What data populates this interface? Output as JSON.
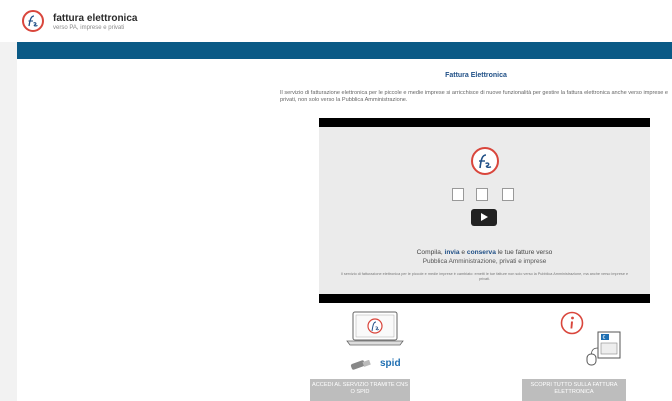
{
  "header": {
    "brand_title": "fattura elettronica",
    "brand_subtitle": "verso PA, imprese e privati"
  },
  "main": {
    "title": "Fattura Elettronica",
    "description": "Il servizio di fatturazione elettronica per le piccole e medie imprese si arricchisce di nuove funzionalità per gestire la fattura elettronica anche verso imprese e privati, non solo verso la Pubblica Amministrazione."
  },
  "video": {
    "headline_pre": "Compila, ",
    "headline_invia": "invia",
    "headline_mid": " e ",
    "headline_conserva": "conserva",
    "headline_post": " le tue fatture verso",
    "headline_line2": "Pubblica Amministrazione, privati e imprese",
    "small_text": "Il servizio di fatturazione elettronica per le piccole e medie imprese è cambiato: emetti le tue fatture non solo verso la Pubblica Amministrazione, ma anche verso imprese e privati."
  },
  "actions": {
    "spid_label": "spid",
    "access_button": "ACCEDI AL SERVIZIO TRAMITE CNS O SPID",
    "discover_button": "SCOPRI TUTTO SULLA FATTURA ELETTRONICA"
  },
  "colors": {
    "blue_bar": "#0a5a86",
    "logo_red": "#d9463c",
    "title_blue": "#1f4f86",
    "button_gray": "#bdbdbd"
  }
}
